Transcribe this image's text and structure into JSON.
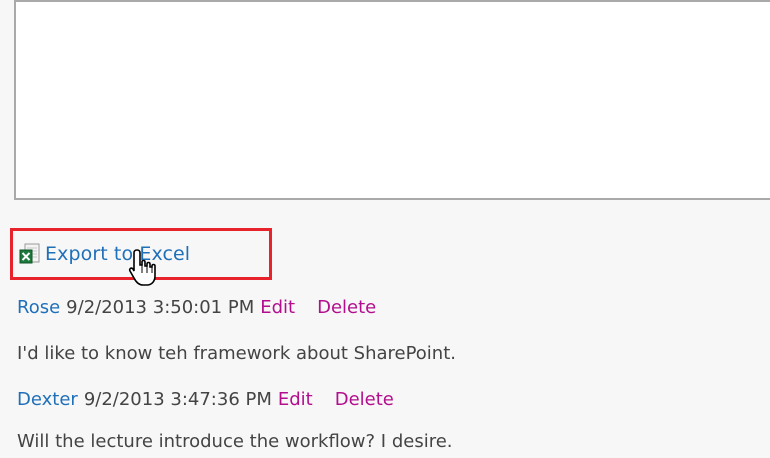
{
  "export": {
    "label": "Export to Excel"
  },
  "comments": [
    {
      "user": "Rose",
      "date": "9/2/2013 3:50:01 PM",
      "edit": "Edit",
      "delete": "Delete",
      "text": "I'd like to know teh framework about SharePoint."
    },
    {
      "user": "Dexter",
      "date": "9/2/2013 3:47:36 PM",
      "edit": "Edit",
      "delete": "Delete",
      "text": "Will the lecture introduce the workflow? I desire."
    }
  ],
  "colors": {
    "link": "#1f6fb9",
    "action": "#b30e8e",
    "highlight": "#e8232c",
    "text": "#444444"
  },
  "icons": {
    "export": "excel-icon",
    "pointer": "hand-cursor-icon"
  }
}
